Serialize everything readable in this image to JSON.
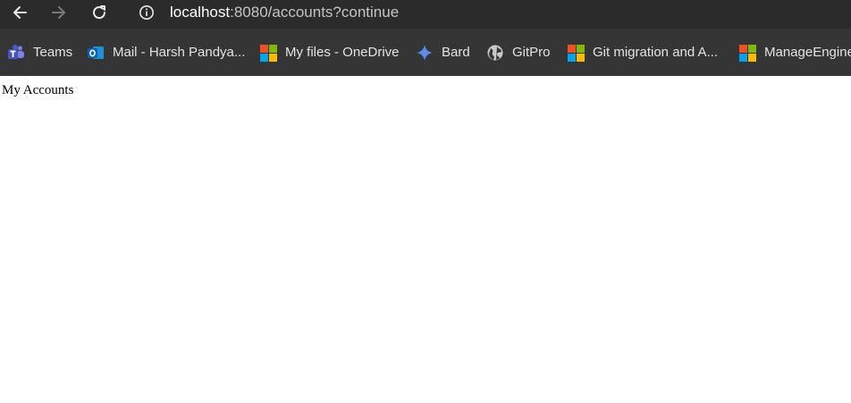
{
  "browser": {
    "url_host": "localhost",
    "url_rest": ":8080/accounts?continue"
  },
  "bookmarks": [
    {
      "label": "Teams",
      "icon": "teams-icon"
    },
    {
      "label": "Mail - Harsh Pandya...",
      "icon": "outlook-icon"
    },
    {
      "label": "My files - OneDrive",
      "icon": "microsoft-icon"
    },
    {
      "label": "Bard",
      "icon": "bard-icon"
    },
    {
      "label": "GitPro",
      "icon": "globe-icon"
    },
    {
      "label": "Git migration and A...",
      "icon": "microsoft-icon"
    },
    {
      "label": "ManageEngine",
      "icon": "microsoft-icon"
    }
  ],
  "page": {
    "heading": "My Accounts"
  },
  "colors": {
    "toolbar_bg": "#2b2b2b",
    "bookmarks_bg": "#353535",
    "ms_red": "#f25022",
    "ms_green": "#7fba00",
    "ms_blue": "#00a4ef",
    "ms_yellow": "#ffb900"
  }
}
